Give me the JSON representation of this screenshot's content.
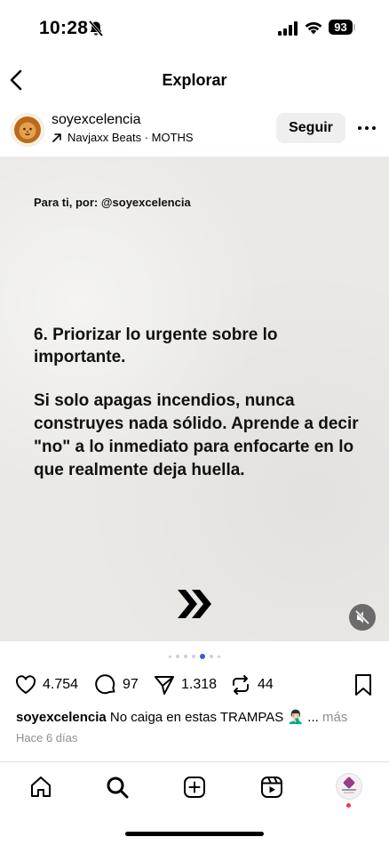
{
  "status_bar": {
    "time": "10:28",
    "battery": "93"
  },
  "header": {
    "title": "Explorar"
  },
  "post": {
    "username": "soyexcelencia",
    "music": "Navjaxx Beats · MOTHS",
    "follow_label": "Seguir",
    "image": {
      "intro": "Para ti, por: @soyexcelencia",
      "heading": "6. Priorizar lo urgente sobre lo importante.",
      "body": "Si solo apagas incendios, nunca construyes nada sólido. Aprende a decir \"no\" a lo inmediato para enfocarte en lo que realmente deja huella."
    },
    "carousel": {
      "count": 7,
      "active_index": 4
    },
    "likes": "4.754",
    "comments": "97",
    "shares": "1.318",
    "reposts": "44",
    "caption_user": "soyexcelencia",
    "caption_text": "No caiga en estas TRAMPAS 🤦🏻‍♂️ ...",
    "more_label": "más",
    "posted": "Hace 6 días"
  },
  "tabs": [
    {
      "icon": "home-icon"
    },
    {
      "icon": "search-icon"
    },
    {
      "icon": "create-icon"
    },
    {
      "icon": "reels-icon"
    },
    {
      "icon": "profile-avatar"
    }
  ],
  "colors": {
    "accent_dot": "#3b5bdb",
    "notification": "#ff2d55"
  }
}
